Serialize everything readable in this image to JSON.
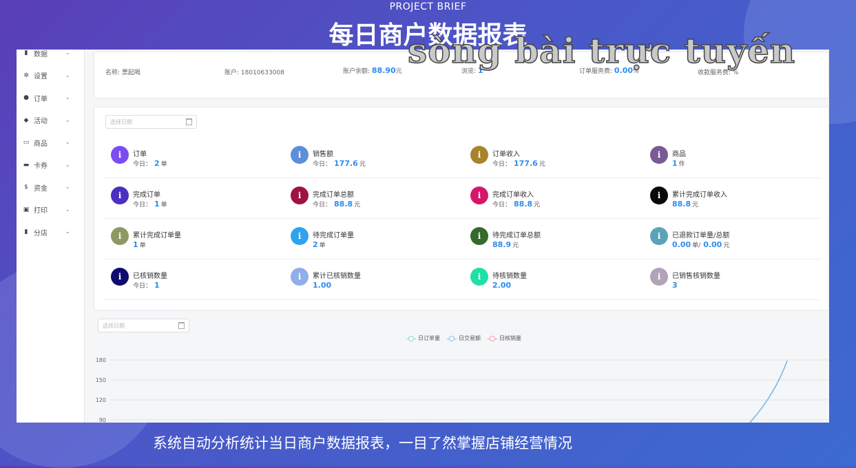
{
  "slide": {
    "subtitle": "PROJECT BRIEF",
    "title": "每日商户数据报表",
    "watermark": "sòng bài trực tuyến",
    "caption": "系统自动分析统计当日商户数据报表，一目了然掌握店铺经营情况"
  },
  "sidebar": {
    "items": [
      {
        "icon": "bar-chart-icon",
        "glyph": "▮",
        "label": "数据"
      },
      {
        "icon": "gear-icon",
        "glyph": "✲",
        "label": "设置"
      },
      {
        "icon": "order-icon",
        "glyph": "●",
        "label": "订单"
      },
      {
        "icon": "tag-icon",
        "glyph": "◆",
        "label": "活动"
      },
      {
        "icon": "shop-icon",
        "glyph": "▭",
        "label": "商品"
      },
      {
        "icon": "card-icon",
        "glyph": "▬",
        "label": "卡券"
      },
      {
        "icon": "dollar-icon",
        "glyph": "$",
        "label": "资金"
      },
      {
        "icon": "printer-icon",
        "glyph": "▣",
        "label": "打印"
      },
      {
        "icon": "store-chart-icon",
        "glyph": "▮",
        "label": "分店"
      }
    ],
    "chevron": "⌄"
  },
  "merchant_info": {
    "name_label": "名称: ",
    "name_value": "票起喝",
    "account_label": "账户: ",
    "account_value": "18010633008",
    "balance_label": "账户余额: ",
    "balance_value": "88.90",
    "balance_unit": "元",
    "browse_label": "浏览: ",
    "browse_value": "1",
    "order_fee_label": "订单服务费: ",
    "order_fee_value": "0.00",
    "order_fee_unit": "%",
    "collect_fee_label": "收款服务费: ",
    "collect_fee_unit": "%"
  },
  "date_picker": {
    "placeholder": "选择日期"
  },
  "stats": [
    {
      "title": "订单",
      "prefix": "今日：",
      "value": "2",
      "unit": "单",
      "color": "#7b4cf2"
    },
    {
      "title": "销售额",
      "prefix": "今日：",
      "value": "177.6",
      "unit": "元",
      "color": "#5b8fd8"
    },
    {
      "title": "订单收入",
      "prefix": "今日：",
      "value": "177.6",
      "unit": "元",
      "color": "#a8832e"
    },
    {
      "title": "商品",
      "prefix": "",
      "value": "1",
      "unit": "件",
      "color": "#7a5a94"
    },
    {
      "title": "完成订单",
      "prefix": "今日：",
      "value": "1",
      "unit": "单",
      "color": "#4b2fc2"
    },
    {
      "title": "完成订单总额",
      "prefix": "今日：",
      "value": "88.8",
      "unit": "元",
      "color": "#a0123f"
    },
    {
      "title": "完成订单收入",
      "prefix": "今日：",
      "value": "88.8",
      "unit": "元",
      "color": "#d6166b"
    },
    {
      "title": "累计完成订单收入",
      "prefix": "",
      "value": "88.8",
      "unit": "元",
      "color": "#0a0a0a"
    },
    {
      "title": "累计完成订单量",
      "prefix": "",
      "value": "1",
      "unit": "单",
      "color": "#8c9a62"
    },
    {
      "title": "待完成订单量",
      "prefix": "",
      "value": "2",
      "unit": "单",
      "color": "#2fa3ee"
    },
    {
      "title": "待完成订单总额",
      "prefix": "",
      "value": "88.9",
      "unit": "元",
      "color": "#346a2a"
    },
    {
      "title": "已退款订单量/总额",
      "prefix": "",
      "value": "0.00",
      "unit": "单/",
      "value2": "0.00",
      "unit2": "元",
      "color": "#5aa3b8"
    },
    {
      "title": "已核销数量",
      "prefix": "今日：",
      "value": "1",
      "unit": "",
      "color": "#0e0a6e"
    },
    {
      "title": "累计已核销数量",
      "prefix": "",
      "value": "1.00",
      "unit": "",
      "color": "#8faeea"
    },
    {
      "title": "待核销数量",
      "prefix": "",
      "value": "2.00",
      "unit": "",
      "color": "#21e0a6"
    },
    {
      "title": "已销售核销数量",
      "prefix": "",
      "value": "3",
      "unit": "",
      "color": "#b2a3b8"
    }
  ],
  "stat_icon_glyph": "i",
  "chart_data": {
    "type": "line",
    "legend": [
      "日订单量",
      "日交易额",
      "日核销量"
    ],
    "legend_colors": [
      "#7fd8cf",
      "#8fb8e8",
      "#ef9aa6"
    ],
    "yticks": [
      180,
      150,
      120,
      90
    ],
    "ylim": [
      90,
      180
    ],
    "grid": true,
    "visible_series_color": "#6fb6ea"
  }
}
